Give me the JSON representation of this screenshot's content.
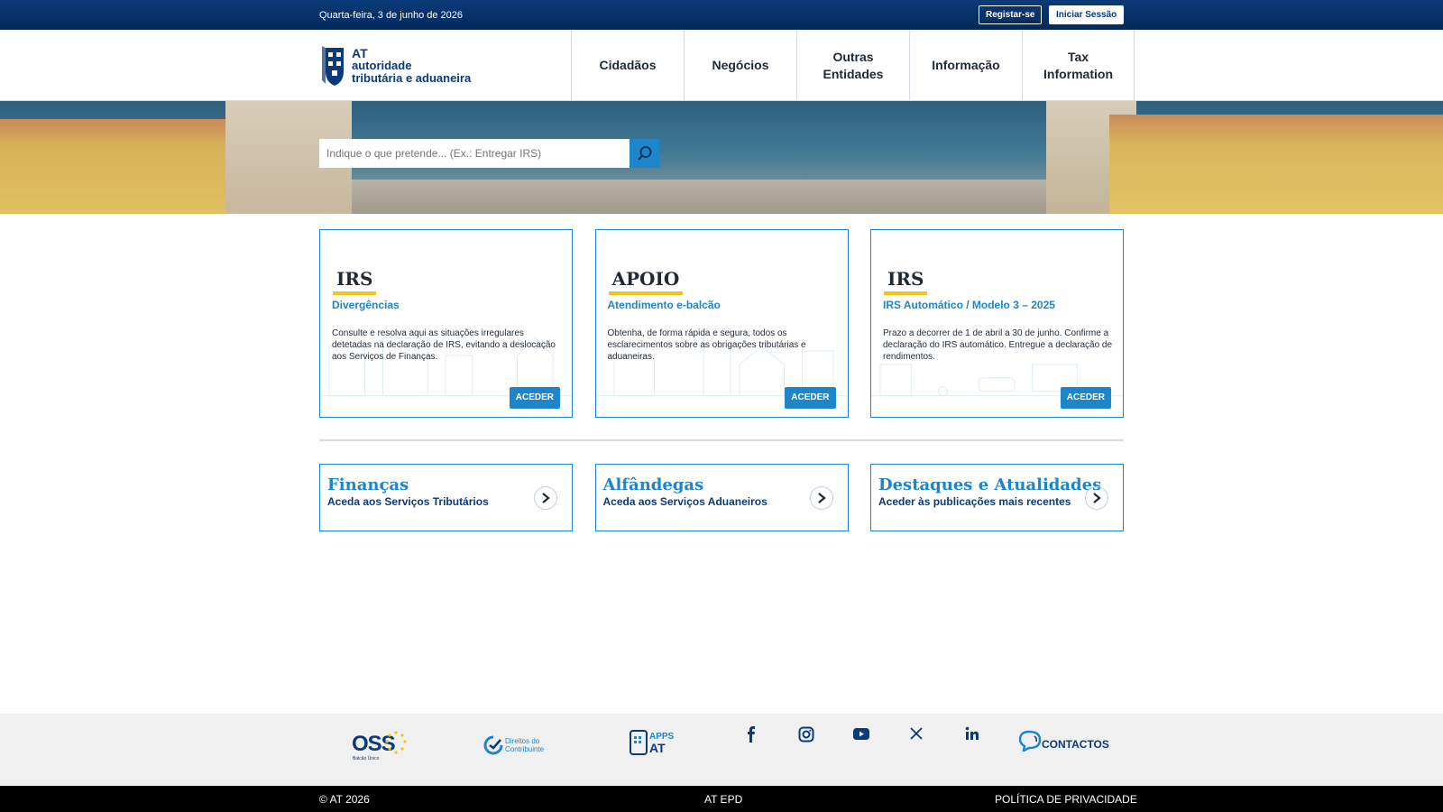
{
  "topbar": {
    "date": "Quarta-feira, 3 de junho de 2026",
    "register_label": "Registar-se",
    "login_label": "Iniciar Sessão"
  },
  "header": {
    "logo_at": "AT",
    "logo_line1": "autoridade",
    "logo_line2": "tributária e aduaneira",
    "nav": [
      {
        "label": "Cidadãos"
      },
      {
        "label": "Negócios"
      },
      {
        "label": "Outras Entidades"
      },
      {
        "label": "Informação"
      },
      {
        "label": "Tax Information"
      }
    ]
  },
  "search": {
    "placeholder": "Indique o que pretende... (Ex.: Entregar IRS)",
    "icon": "search-icon"
  },
  "cards": [
    {
      "title": "IRS",
      "subtitle": "Divergências",
      "description": "Consulte e resolva aqui as situações irregulares detetadas na declaração de IRS, evitando a deslocação aos Serviços de Finanças.",
      "button": "ACEDER"
    },
    {
      "title": "APOIO",
      "subtitle": "Atendimento e-balcão",
      "description": "Obtenha, de forma rápida e segura, todos os esclarecimentos sobre as obrigações tributárias e aduaneiras.",
      "button": "ACEDER"
    },
    {
      "title": "IRS",
      "subtitle": "IRS Automático / Modelo 3 – 2025",
      "description": "Prazo a decorrer de 1 de abril a 30 de junho. Confirme a declaração do IRS automático. Entregue a declaração de rendimentos.",
      "button": "ACEDER"
    }
  ],
  "links": [
    {
      "title": "Finanças",
      "subtitle": "Aceda aos Serviços Tributários"
    },
    {
      "title": "Alfândegas",
      "subtitle": "Aceda aos Serviços Aduaneiros"
    },
    {
      "title": "Destaques e Atualidades",
      "subtitle": "Aceder às publicações mais recentes"
    }
  ],
  "footer": {
    "oss_label": "OSS",
    "oss_sub": "Balcão Único",
    "rights_line1": "Direitos do",
    "rights_line2": "Contribuinte",
    "apps_line1": "APPS",
    "apps_line2": "AT",
    "contacts_label": "CONTACTOS",
    "social": [
      "facebook-icon",
      "instagram-icon",
      "youtube-icon",
      "x-icon",
      "linkedin-icon"
    ]
  },
  "bottombar": {
    "copyright": "© AT 2026",
    "epd": "AT EPD",
    "privacy": "POLÍTICA DE PRIVACIDADE"
  },
  "colors": {
    "primary_dark": "#0a3a78",
    "accent_blue": "#1d85c9",
    "highlight_yellow": "#f0c419"
  }
}
